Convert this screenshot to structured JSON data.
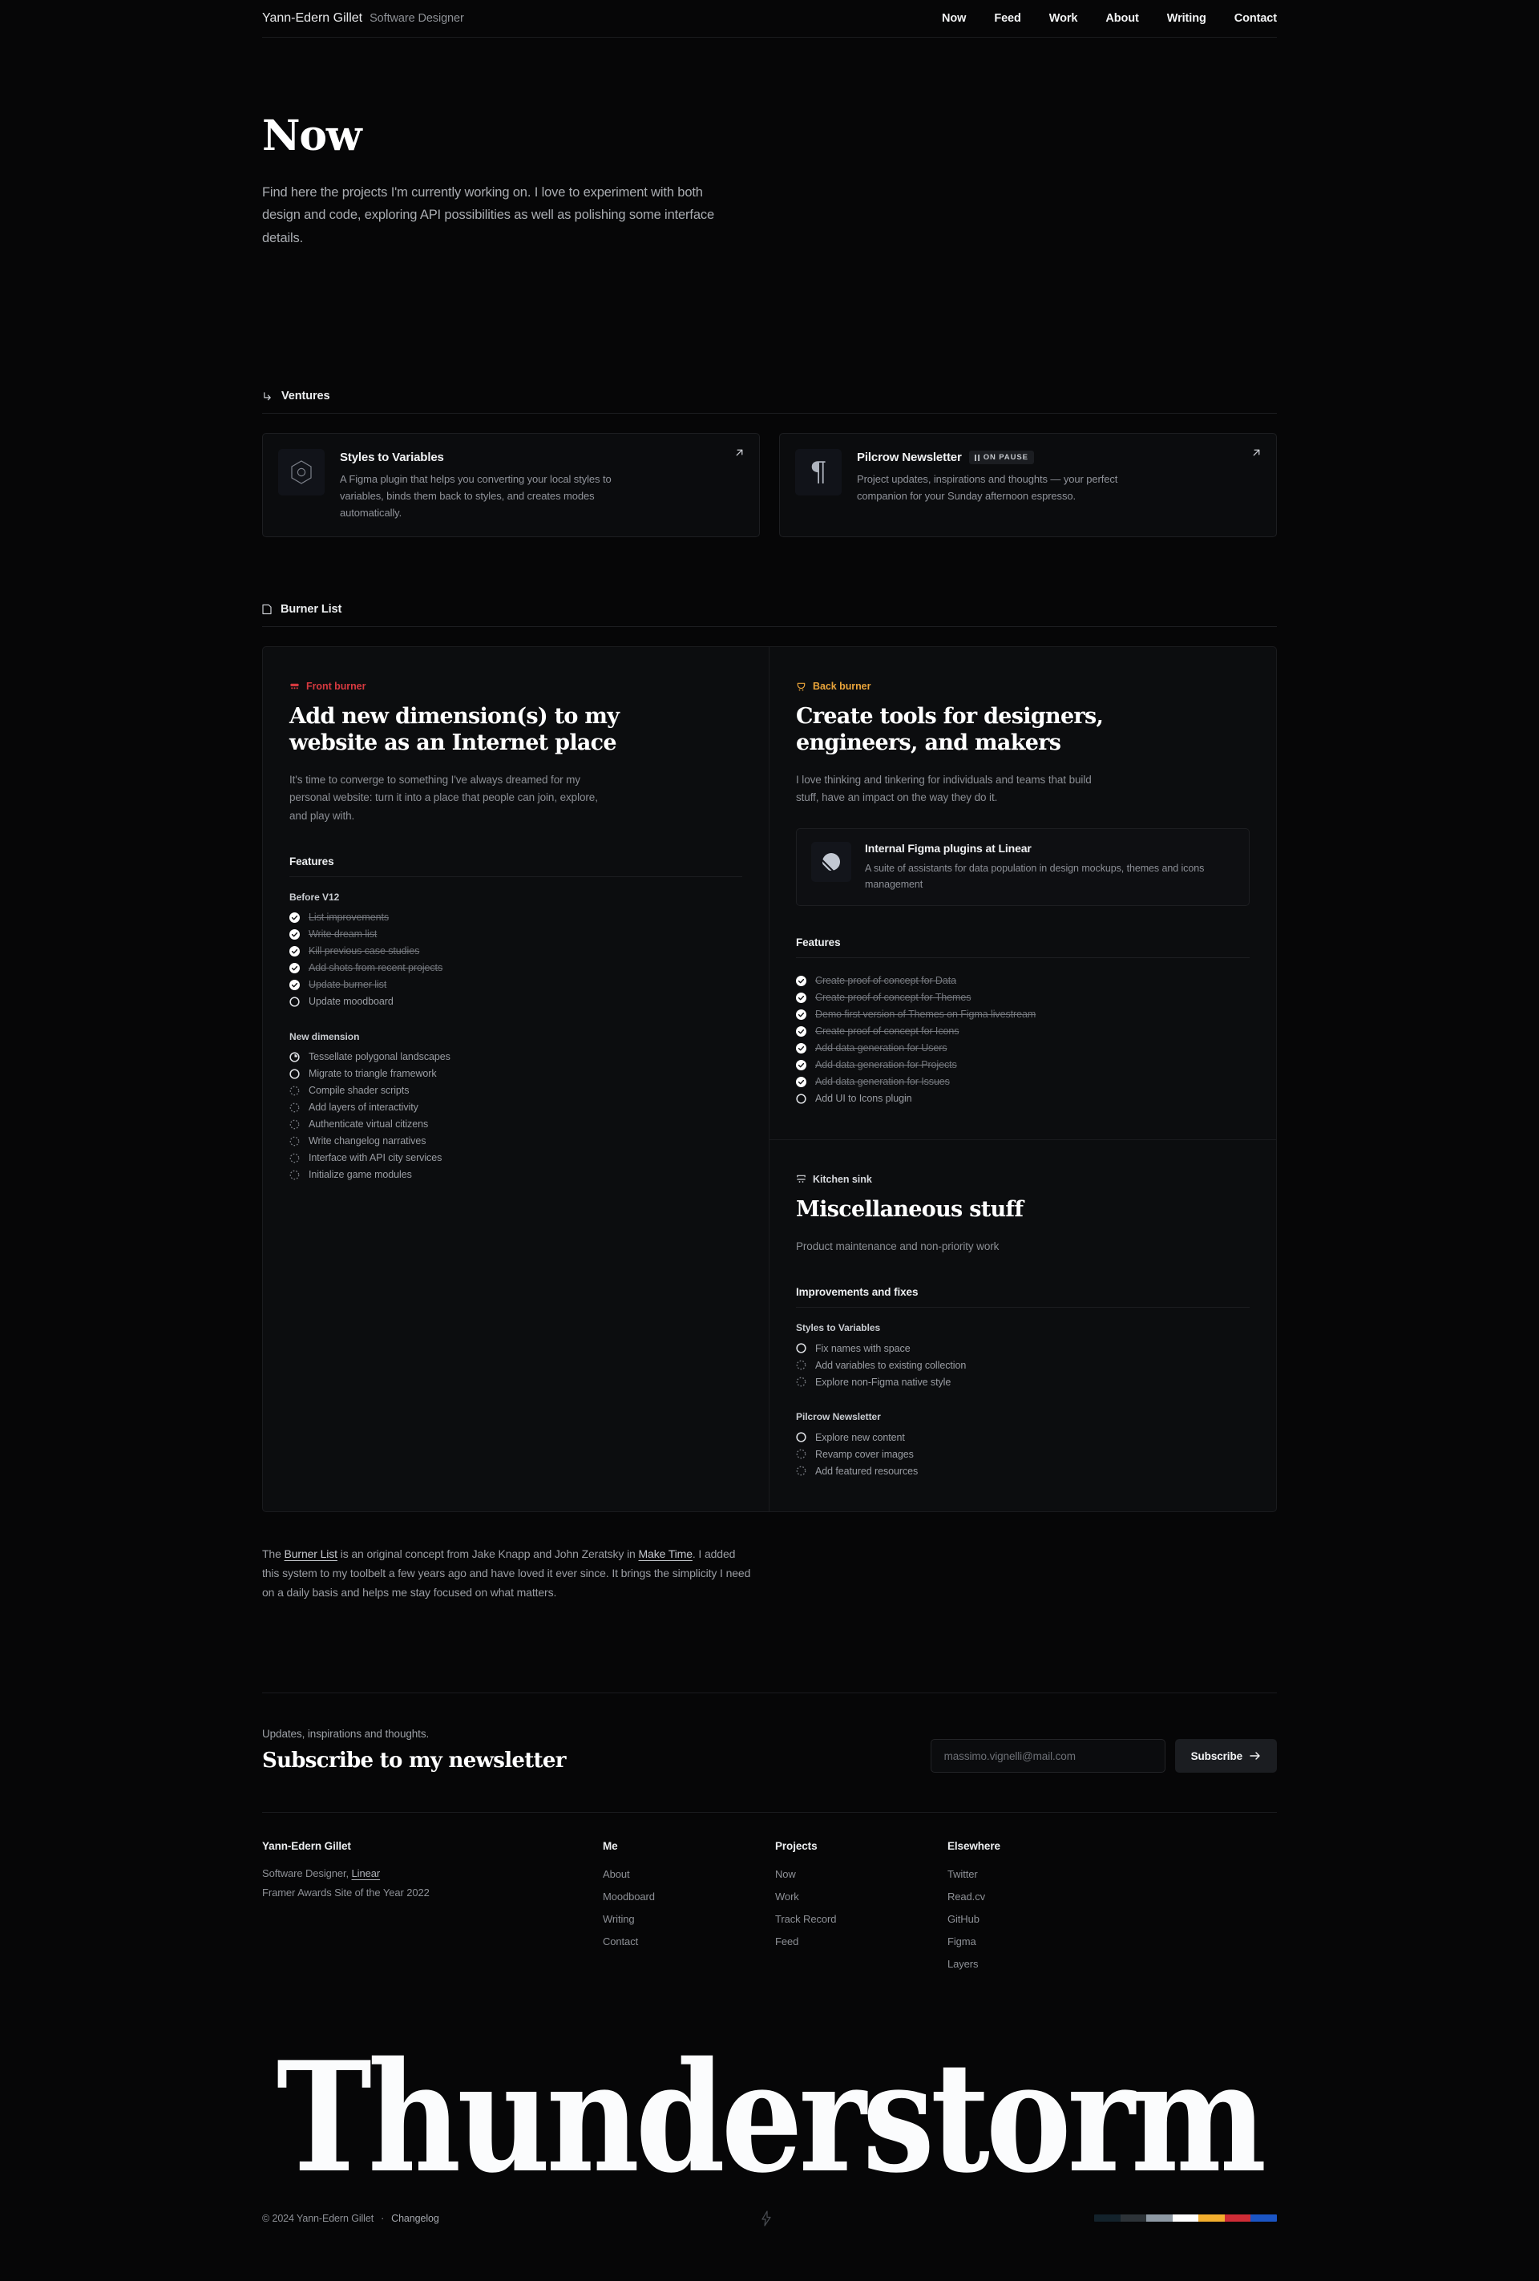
{
  "header": {
    "brand_name": "Yann-Edern Gillet",
    "brand_role": "Software Designer",
    "nav": [
      {
        "label": "Now"
      },
      {
        "label": "Feed"
      },
      {
        "label": "Work"
      },
      {
        "label": "About"
      },
      {
        "label": "Writing"
      },
      {
        "label": "Contact"
      }
    ]
  },
  "hero": {
    "title": "Now",
    "body": "Find here the projects I'm currently working on. I love to experiment with both design and code, exploring API possibilities as well as polishing some interface details."
  },
  "ventures": {
    "section_label": "Ventures",
    "section_icon": "arrow-turn-down-right-icon",
    "cards": [
      {
        "icon": "hexagon-outline-icon",
        "title": "Styles to Variables",
        "badge": null,
        "description": "A Figma plugin that helps you converting your local styles to variables, binds them back to styles, and creates modes automatically.",
        "link_icon": "arrow-up-right-icon"
      },
      {
        "icon": "pilcrow-icon",
        "title": "Pilcrow Newsletter",
        "badge": "ON PAUSE",
        "badge_icon": "pause-icon",
        "description": "Project updates, inspirations and thoughts — your perfect companion for your Sunday afternoon espresso.",
        "link_icon": "arrow-up-right-icon"
      }
    ]
  },
  "burner": {
    "section_label": "Burner List",
    "section_icon": "note-icon",
    "front": {
      "tag": "Front burner",
      "tag_icon": "front-burner-icon",
      "tag_color": "#d6393f",
      "title": "Add new dimension(s) to my website as an Internet place",
      "lede": "It's time to converge to something I've always dreamed for my personal website: turn it into a place that people can join, explore, and play with.",
      "features_label": "Features",
      "groups": [
        {
          "title": "Before V12",
          "tasks": [
            {
              "label": "List improvements",
              "state": "done"
            },
            {
              "label": "Write dream list",
              "state": "done"
            },
            {
              "label": "Kill previous case studies",
              "state": "done"
            },
            {
              "label": "Add shots from recent projects",
              "state": "done"
            },
            {
              "label": "Update burner list",
              "state": "done"
            },
            {
              "label": "Update moodboard",
              "state": "todo"
            }
          ]
        },
        {
          "title": "New dimension",
          "tasks": [
            {
              "label": "Tessellate polygonal landscapes",
              "state": "progress"
            },
            {
              "label": "Migrate to triangle framework",
              "state": "todo"
            },
            {
              "label": "Compile shader scripts",
              "state": "pending"
            },
            {
              "label": "Add layers of interactivity",
              "state": "pending"
            },
            {
              "label": "Authenticate virtual citizens",
              "state": "pending"
            },
            {
              "label": "Write changelog narratives",
              "state": "pending"
            },
            {
              "label": "Interface with API city services",
              "state": "pending"
            },
            {
              "label": "Initialize game modules",
              "state": "pending"
            }
          ]
        }
      ]
    },
    "back": {
      "tag": "Back burner",
      "tag_icon": "back-burner-icon",
      "tag_color": "#e8a33a",
      "title": "Create tools for designers, engineers, and makers",
      "lede": "I love thinking and tinkering for individuals and teams that build stuff, have an impact on the way they do it.",
      "mini_card": {
        "icon": "linear-icon",
        "title": "Internal Figma plugins at Linear",
        "description": "A suite of assistants for data population in design mockups, themes and icons management"
      },
      "features_label": "Features",
      "groups": [
        {
          "title": null,
          "tasks": [
            {
              "label": "Create proof of concept for Data",
              "state": "done"
            },
            {
              "label": "Create proof of concept for Themes",
              "state": "done"
            },
            {
              "label": "Demo first version of Themes on Figma livestream",
              "state": "done"
            },
            {
              "label": "Create proof of concept for Icons",
              "state": "done"
            },
            {
              "label": "Add data generation for Users",
              "state": "done"
            },
            {
              "label": "Add data generation for Projects",
              "state": "done"
            },
            {
              "label": "Add data generation for Issues",
              "state": "done"
            },
            {
              "label": "Add UI to Icons plugin",
              "state": "todo"
            }
          ]
        }
      ]
    },
    "sink": {
      "tag": "Kitchen sink",
      "tag_icon": "kitchen-sink-icon",
      "tag_color": "#d8dade",
      "title": "Miscellaneous stuff",
      "lede": "Product maintenance and non-priority work",
      "features_label": "Improvements and fixes",
      "groups": [
        {
          "title": "Styles to Variables",
          "tasks": [
            {
              "label": "Fix names with space",
              "state": "todo"
            },
            {
              "label": "Add variables to existing collection",
              "state": "pending"
            },
            {
              "label": "Explore non-Figma native style",
              "state": "pending"
            }
          ]
        },
        {
          "title": "Pilcrow Newsletter",
          "tasks": [
            {
              "label": "Explore new content",
              "state": "todo"
            },
            {
              "label": "Revamp cover images",
              "state": "pending"
            },
            {
              "label": "Add featured resources",
              "state": "pending"
            }
          ]
        }
      ]
    },
    "note": {
      "p1": "The ",
      "link1": "Burner List",
      "p2": " is an original concept from Jake Knapp and John Zeratsky in ",
      "link2": "Make Time",
      "p3": ". I added this system to my toolbelt a few years ago and have loved it ever since. It brings the simplicity I need on a daily basis and helps me stay focused on what matters."
    }
  },
  "newsletter": {
    "kicker": "Updates, inspirations and thoughts.",
    "title": "Subscribe to my newsletter",
    "email_placeholder": "massimo.vignelli@mail.com",
    "email_value": "",
    "button_label": "Subscribe",
    "button_icon": "arrow-right-icon"
  },
  "footer": {
    "name": "Yann-Edern Gillet",
    "role_prefix": "Software Designer, ",
    "role_link": "Linear",
    "award": "Framer Awards Site of the Year 2022",
    "columns": [
      {
        "heading": "Me",
        "links": [
          "About",
          "Moodboard",
          "Writing",
          "Contact"
        ]
      },
      {
        "heading": "Projects",
        "links": [
          "Now",
          "Work",
          "Track Record",
          "Feed"
        ]
      },
      {
        "heading": "Elsewhere",
        "links": [
          "Twitter",
          "Read.cv",
          "GitHub",
          "Figma",
          "Layers"
        ]
      }
    ]
  },
  "wordmark": "Thunderstorm",
  "bottom": {
    "copyright": "© 2024 Yann-Edern Gillet",
    "separator": "·",
    "changelog": "Changelog",
    "center_icon": "lightning-bolt-icon",
    "swatches": [
      "#13222b",
      "#2d3338",
      "#8e99a4",
      "#ffffff",
      "#f2ae2e",
      "#cf2c36",
      "#1b55c4"
    ]
  }
}
